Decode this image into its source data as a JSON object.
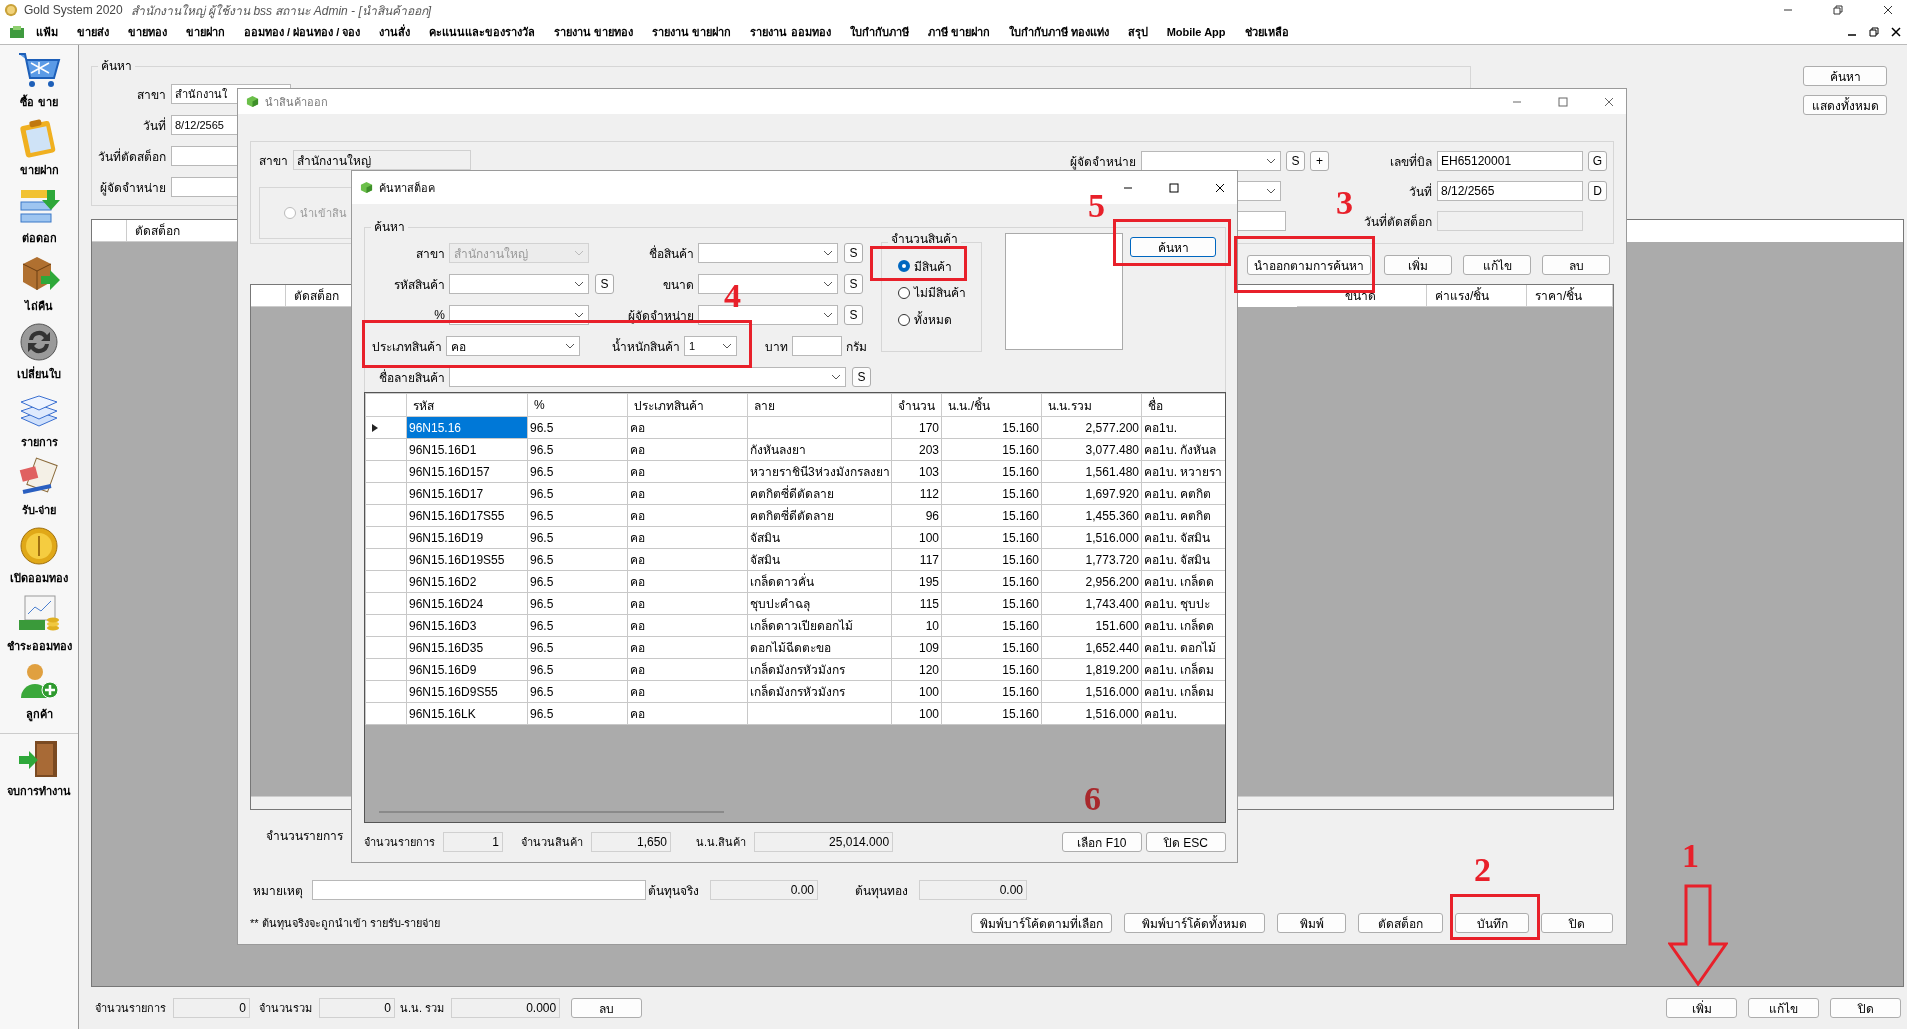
{
  "window": {
    "app_name": "Gold System 2020",
    "title": "สำนักงานใหญ่ ผู้ใช้งาน bss สถานะ Admin - [นำสินค้าออก]"
  },
  "menu": [
    "แฟ้ม",
    "ขายส่ง",
    "ขายทอง",
    "ขายฝาก",
    "ออมทอง / ผ่อนทอง / จอง",
    "งานสั่ง",
    "คะแนนและของรางวัล",
    "รายงาน ขายทอง",
    "รายงาน ขายฝาก",
    "รายงาน ออมทอง",
    "ใบกำกับภาษี",
    "ภาษี ขายฝาก",
    "ใบกำกับภาษี ทองแท่ง",
    "สรุป",
    "Mobile App",
    "ช่วยเหลือ"
  ],
  "sidebar": {
    "items": [
      {
        "label": "ซื้อ ขาย",
        "kind": "cart"
      },
      {
        "label": "ขายฝาก",
        "kind": "clipboard"
      },
      {
        "label": "ต่อดอก",
        "kind": "bars"
      },
      {
        "label": "ไถ่คืน",
        "kind": "box"
      },
      {
        "label": "เปลี่ยนใบ",
        "kind": "cycle"
      },
      {
        "label": "รายการ",
        "kind": "layers"
      },
      {
        "label": "รับ-จ่าย",
        "kind": "pen"
      },
      {
        "label": "เปิดออมทอง",
        "kind": "coin"
      },
      {
        "label": "ชำระออมทอง",
        "kind": "chart"
      },
      {
        "label": "ลูกค้า",
        "kind": "user"
      },
      {
        "label": "จบการทำงาน",
        "kind": "door"
      }
    ]
  },
  "main": {
    "group_title": "ค้นหา",
    "fields": [
      {
        "label": "สาขา",
        "value": "สำนักงานใ"
      },
      {
        "label": "วันที่",
        "value": "8/12/2565"
      },
      {
        "label": "วันที่ตัดสต็อก"
      },
      {
        "label": "ผู้จัดจำหน่าย"
      }
    ],
    "side_buttons": [
      "ค้นหา",
      "แสดงทั้งหมด"
    ],
    "table_columns": [
      "ตัดสต็อก"
    ],
    "footer_fields": [
      {
        "label": "จำนวนรายการ",
        "value": "0"
      },
      {
        "label": "จำนวนรวม",
        "value": "0"
      },
      {
        "label": "น.น. รวม",
        "value": "0.000"
      }
    ],
    "footer_left_button": "ลบ",
    "footer_buttons": [
      "เพิ่ม",
      "แก้ไข",
      "ปิด"
    ]
  },
  "export_dialog": {
    "title": "นำสินค้าออก",
    "branch": {
      "label": "สาขา",
      "value": "สำนักงานใหญ่"
    },
    "import_radio": {
      "label": "นำเข้าสิน",
      "selected": false,
      "disabled": true
    },
    "supplier": {
      "label": "ผู้จัดจำหน่าย",
      "buttons": [
        "S",
        "+"
      ]
    },
    "bill_fields": [
      {
        "label": "เลขที่บิล",
        "value": "EH65120001",
        "button": "G"
      },
      {
        "label": "วันที่",
        "value": "8/12/2565",
        "button": "D"
      },
      {
        "label": "วันที่ตัดสต็อก"
      }
    ],
    "actions": [
      "นำออกตามการค้นหา",
      "เพิ่ม",
      "แก้ไข",
      "ลบ"
    ],
    "table_columns_left": [
      "ตัดสต็อก"
    ],
    "table_columns_right": [
      "ขนาด",
      "ค่าแรง/ชิ้น",
      "ราคา/ชิ้น"
    ],
    "count_label": "จำนวนรายการ",
    "note_label": "หมายเหตุ",
    "cost_fields": [
      {
        "label": "ต้นทุนจริง",
        "value": "0.00"
      },
      {
        "label": "ต้นทุนทอง",
        "value": "0.00"
      }
    ],
    "footnote": "** ต้นทุนจริงจะถูกนำเข้า รายรับ-รายจ่าย",
    "buttons": [
      "พิมพ์บาร์โค้ดตามที่เลือก",
      "พิมพ์บาร์โค้ดทั้งหมด",
      "พิมพ์",
      "ตัดสต็อก",
      "บันทึก",
      "ปิด"
    ]
  },
  "stock_dialog": {
    "title": "ค้นหาสต็อค",
    "group_title": "ค้นหา",
    "rows": [
      {
        "fields": [
          {
            "kind": "combo",
            "label": "สาขา",
            "value": "สำนักงานใหญ่",
            "disabled": true
          },
          {
            "kind": "combo",
            "label": "ชื่อสินค้า",
            "button": "S",
            "disabled": false
          }
        ]
      },
      {
        "fields": [
          {
            "kind": "combo",
            "label": "รหัสสินค้า",
            "button": "S",
            "disabled": false
          },
          {
            "kind": "combo",
            "label": "ขนาด",
            "button": "S",
            "disabled": false
          }
        ]
      },
      {
        "fields": [
          {
            "kind": "combo",
            "label": "%",
            "disabled": false
          },
          {
            "kind": "combo",
            "label": "ผู้จัดจำหน่าย",
            "button": "S",
            "disabled": false
          }
        ]
      },
      {
        "fields": [
          {
            "kind": "combo",
            "label": "ประเภทสินค้า",
            "value": "คอ",
            "disabled": false
          },
          {
            "kind": "small",
            "label": "น้ำหนักสินค้า",
            "value": "1",
            "disabled": false
          },
          {
            "kind": "unit",
            "before": "บาท",
            "after": "กรัม"
          }
        ]
      },
      {
        "fields": [
          {
            "kind": "wide",
            "label": "ชื่อลายสินค้า",
            "button": "S",
            "disabled": false
          }
        ]
      }
    ],
    "quantity_group": {
      "title": "จำนวนสินค้า",
      "options": [
        {
          "label": "มีสินค้า",
          "selected": true
        },
        {
          "label": "ไม่มีสินค้า",
          "selected": false
        },
        {
          "label": "ทั้งหมด",
          "selected": false
        }
      ]
    },
    "search_button": "ค้นหา",
    "table": {
      "columns": [
        "รหัส",
        "%",
        "ประเภทสินค้า",
        "ลาย",
        "จำนวน",
        "น.น./ชิ้น",
        "น.น.รวม",
        "ชื่อ"
      ],
      "rows": [
        {
          "selected": true,
          "cells": [
            "96N15.16",
            "96.5",
            "คอ",
            null,
            "170",
            "15.160",
            "2,577.200",
            "คอ1บ."
          ]
        },
        {
          "selected": false,
          "cells": [
            "96N15.16D1",
            "96.5",
            "คอ",
            "กังหันลงยา",
            "203",
            "15.160",
            "3,077.480",
            "คอ1บ. กังหันล"
          ]
        },
        {
          "selected": false,
          "cells": [
            "96N15.16D157",
            "96.5",
            "คอ",
            "หวายราชินี3ห่วงมังกรลงยา",
            "103",
            "15.160",
            "1,561.480",
            "คอ1บ. หวายรา"
          ]
        },
        {
          "selected": false,
          "cells": [
            "96N15.16D17",
            "96.5",
            "คอ",
            "คตกิตซี่ดีตัดลาย",
            "112",
            "15.160",
            "1,697.920",
            "คอ1บ. คตกิต"
          ]
        },
        {
          "selected": false,
          "cells": [
            "96N15.16D17S55",
            "96.5",
            "คอ",
            "คตกิตซี่ดีตัดลาย",
            "96",
            "15.160",
            "1,455.360",
            "คอ1บ. คตกิต"
          ]
        },
        {
          "selected": false,
          "cells": [
            "96N15.16D19",
            "96.5",
            "คอ",
            "จัสมิน",
            "100",
            "15.160",
            "1,516.000",
            "คอ1บ. จัสมิน"
          ]
        },
        {
          "selected": false,
          "cells": [
            "96N15.16D19S55",
            "96.5",
            "คอ",
            "จัสมิน",
            "117",
            "15.160",
            "1,773.720",
            "คอ1บ. จัสมิน"
          ]
        },
        {
          "selected": false,
          "cells": [
            "96N15.16D2",
            "96.5",
            "คอ",
            "เกล็ดดาวคั่น",
            "195",
            "15.160",
            "2,956.200",
            "คอ1บ. เกล็ดด"
          ]
        },
        {
          "selected": false,
          "cells": [
            "96N15.16D24",
            "96.5",
            "คอ",
            "ชุบปะคำฉลุ",
            "115",
            "15.160",
            "1,743.400",
            "คอ1บ. ชุบปะ"
          ]
        },
        {
          "selected": false,
          "cells": [
            "96N15.16D3",
            "96.5",
            "คอ",
            "เกล็ดดาวเปียดอกไม้",
            "10",
            "15.160",
            "151.600",
            "คอ1บ. เกล็ดด"
          ]
        },
        {
          "selected": false,
          "cells": [
            "96N15.16D35",
            "96.5",
            "คอ",
            "ดอกไม้ฉีดตะขอ",
            "109",
            "15.160",
            "1,652.440",
            "คอ1บ. ดอกไม้"
          ]
        },
        {
          "selected": false,
          "cells": [
            "96N15.16D9",
            "96.5",
            "คอ",
            "เกล็ดมังกรหัวมังกร",
            "120",
            "15.160",
            "1,819.200",
            "คอ1บ. เกล็ดม"
          ]
        },
        {
          "selected": false,
          "cells": [
            "96N15.16D9S55",
            "96.5",
            "คอ",
            "เกล็ดมังกรหัวมังกร",
            "100",
            "15.160",
            "1,516.000",
            "คอ1บ. เกล็ดม"
          ]
        },
        {
          "selected": false,
          "cells": [
            "96N15.16LK",
            "96.5",
            "คอ",
            null,
            "100",
            "15.160",
            "1,516.000",
            "คอ1บ."
          ]
        }
      ]
    },
    "footer_fields": [
      {
        "label": "จำนวนรายการ",
        "value": "1"
      },
      {
        "label": "จำนวนสินค้า",
        "value": "1,650"
      },
      {
        "label": "น.น.สินค้า",
        "value": "25,014.000"
      }
    ],
    "buttons": [
      "เลือก F10",
      "ปิด ESC"
    ]
  },
  "annotations": [
    {
      "label": "1",
      "color": "#e8202a"
    },
    {
      "label": "2",
      "color": "#e8202a"
    },
    {
      "label": "3",
      "color": "#e8202a"
    },
    {
      "label": "4",
      "color": "#e8202a"
    },
    {
      "label": "5",
      "color": "#e8202a"
    },
    {
      "label": "6",
      "color": "#a8282c"
    }
  ]
}
